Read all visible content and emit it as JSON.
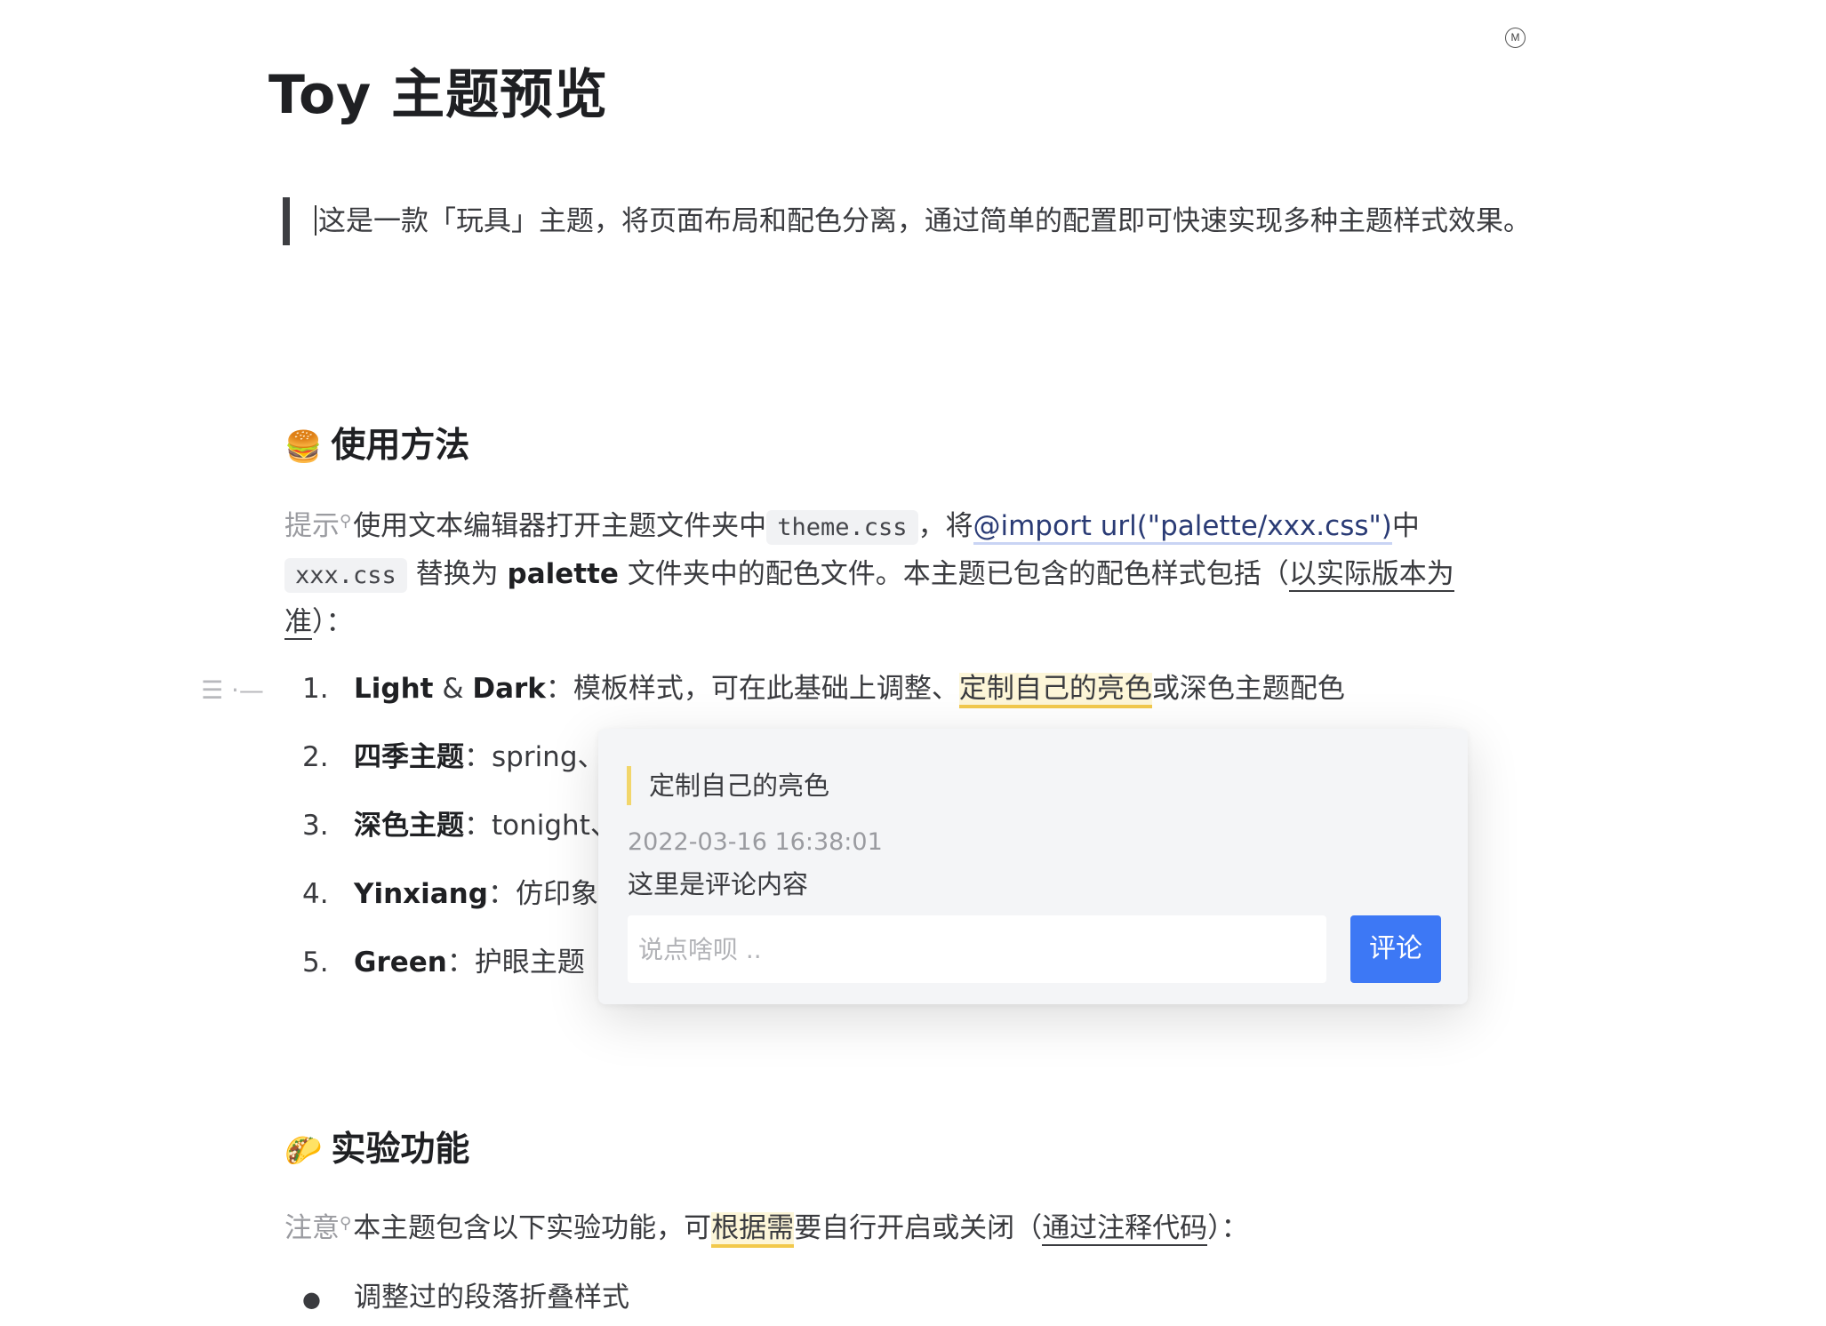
{
  "doc": {
    "title": "Toy 主题预览",
    "intro": "这是一款「玩具」主题，将页面布局和配色分离，通过简单的配置即可快速实现多种主题样式效果。"
  },
  "badge": "M",
  "section1": {
    "emoji": "🍔",
    "heading": "使用方法",
    "tip_label": "提示",
    "p1": "使用文本编辑器打开主题文件夹中",
    "code1": "theme.css",
    "p2": "，将",
    "import_text": "@import url(\"palette/xxx.css\")",
    "p3": "中",
    "code2": "xxx.css",
    "p4": "替换为",
    "palette_word": "palette",
    "p5": "文件夹中的配色文件。本主题已包含的配色样式包括（",
    "underline_text": "以实际版本为准",
    "p6": "）："
  },
  "list": [
    {
      "num": "1.",
      "bold": "Light",
      "amp": " & ",
      "bold2": "Dark",
      "sep": "：",
      "text": "模板样式，可在此基础上调整、",
      "highlight": "定制自己的亮色",
      "rest": "或深色主题配色"
    },
    {
      "num": "2.",
      "bold": "四季主题",
      "sep": "：",
      "text": "spring、"
    },
    {
      "num": "3.",
      "bold": "深色主题",
      "sep": "：",
      "text": "tonight、"
    },
    {
      "num": "4.",
      "bold": "Yinxiang",
      "sep": "：",
      "text": "仿印象笔"
    },
    {
      "num": "5.",
      "bold": "Green",
      "sep": "：",
      "text": "护眼主题"
    }
  ],
  "gutter_icons": "☰ ·—",
  "comment": {
    "quote": "定制自己的亮色",
    "time": "2022-03-16 16:38:01",
    "content": "这里是评论内容",
    "placeholder": "说点啥呗 ..",
    "button": "评论"
  },
  "section2": {
    "emoji": "🌮",
    "heading": "实验功能",
    "note_label": "注意",
    "p1": "本主题包含以下实验功能，可",
    "highlight": "根据需",
    "p2": "要自行开启或关闭（",
    "underline_text": "通过注释代码",
    "p3": "）："
  },
  "bullets": [
    "调整过的段落折叠样式"
  ]
}
